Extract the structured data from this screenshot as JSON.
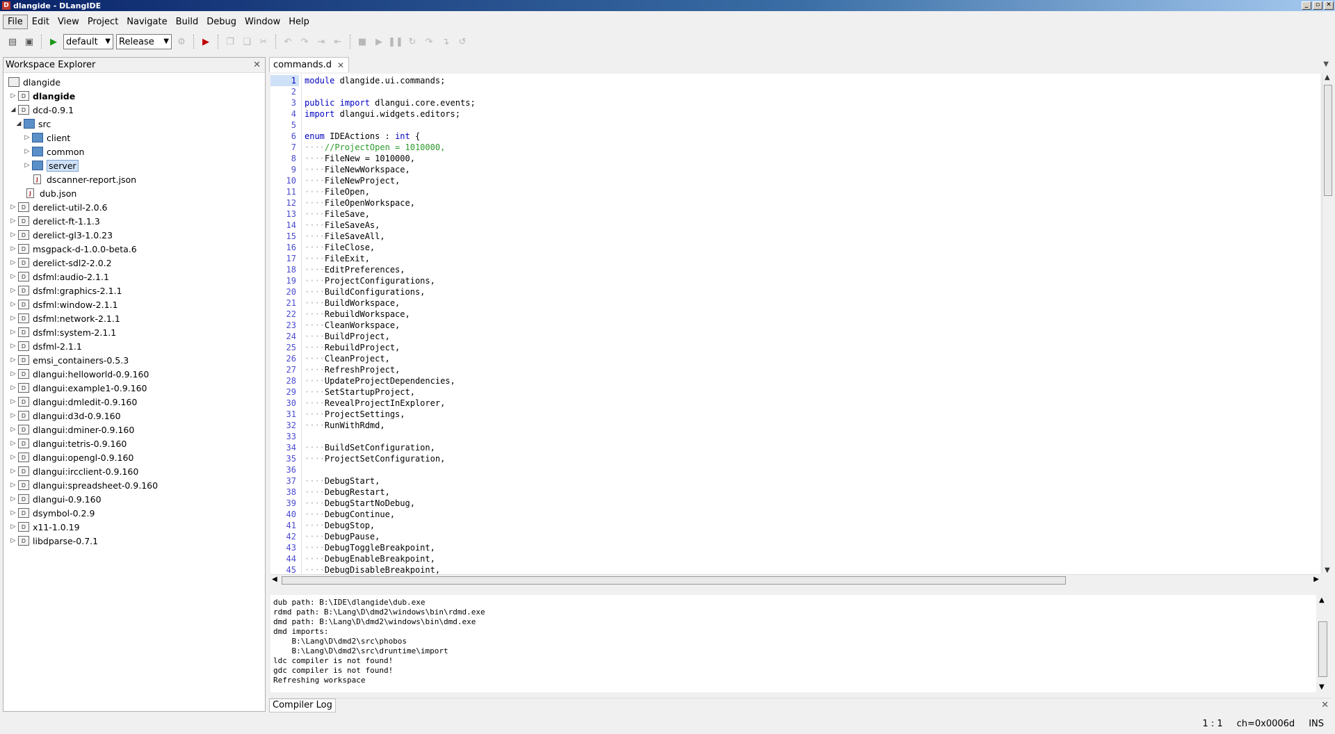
{
  "window": {
    "title": "dlangide - DLangIDE"
  },
  "menu": [
    "File",
    "Edit",
    "View",
    "Project",
    "Navigate",
    "Build",
    "Debug",
    "Window",
    "Help"
  ],
  "toolbar": {
    "config_value": "default",
    "build_value": "Release"
  },
  "workspace": {
    "title": "Workspace Explorer",
    "root": "dlangide",
    "items": [
      {
        "label": "dlangide",
        "bold": true,
        "expanded": false
      },
      {
        "label": "dcd-0.9.1",
        "expanded": true
      },
      {
        "label": "src",
        "folder": true
      },
      {
        "label": "client",
        "folder": true
      },
      {
        "label": "common",
        "folder": true
      },
      {
        "label": "server",
        "folder": true
      },
      {
        "label": "dscanner-report.json"
      },
      {
        "label": "dub.json"
      },
      {
        "label": "derelict-util-2.0.6"
      },
      {
        "label": "derelict-ft-1.1.3"
      },
      {
        "label": "derelict-gl3-1.0.23"
      },
      {
        "label": "msgpack-d-1.0.0-beta.6"
      },
      {
        "label": "derelict-sdl2-2.0.2"
      },
      {
        "label": "dsfml:audio-2.1.1"
      },
      {
        "label": "dsfml:graphics-2.1.1"
      },
      {
        "label": "dsfml:window-2.1.1"
      },
      {
        "label": "dsfml:network-2.1.1"
      },
      {
        "label": "dsfml:system-2.1.1"
      },
      {
        "label": "dsfml-2.1.1"
      },
      {
        "label": "emsi_containers-0.5.3"
      },
      {
        "label": "dlangui:helloworld-0.9.160"
      },
      {
        "label": "dlangui:example1-0.9.160"
      },
      {
        "label": "dlangui:dmledit-0.9.160"
      },
      {
        "label": "dlangui:d3d-0.9.160"
      },
      {
        "label": "dlangui:dminer-0.9.160"
      },
      {
        "label": "dlangui:tetris-0.9.160"
      },
      {
        "label": "dlangui:opengl-0.9.160"
      },
      {
        "label": "dlangui:ircclient-0.9.160"
      },
      {
        "label": "dlangui:spreadsheet-0.9.160"
      },
      {
        "label": "dlangui-0.9.160"
      },
      {
        "label": "dsymbol-0.2.9"
      },
      {
        "label": "x11-1.0.19"
      },
      {
        "label": "libdparse-0.7.1"
      }
    ],
    "icon_label": "D"
  },
  "editor": {
    "tab": "commands.d",
    "lines": [
      "module dlangide.ui.commands;",
      "",
      "public import dlangui.core.events;",
      "import dlangui.widgets.editors;",
      "",
      "enum IDEActions : int {",
      "    //ProjectOpen = 1010000,",
      "    FileNew = 1010000,",
      "    FileNewWorkspace,",
      "    FileNewProject,",
      "    FileOpen,",
      "    FileOpenWorkspace,",
      "    FileSave,",
      "    FileSaveAs,",
      "    FileSaveAll,",
      "    FileClose,",
      "    FileExit,",
      "    EditPreferences,",
      "    ProjectConfigurations,",
      "    BuildConfigurations,",
      "    BuildWorkspace,",
      "    RebuildWorkspace,",
      "    CleanWorkspace,",
      "    BuildProject,",
      "    RebuildProject,",
      "    CleanProject,",
      "    RefreshProject,",
      "    UpdateProjectDependencies,",
      "    SetStartupProject,",
      "    RevealProjectInExplorer,",
      "    ProjectSettings,",
      "    RunWithRdmd,",
      "",
      "    BuildSetConfiguration,",
      "    ProjectSetConfiguration,",
      "",
      "    DebugStart,",
      "    DebugRestart,",
      "    DebugStartNoDebug,",
      "    DebugContinue,",
      "    DebugStop,",
      "    DebugPause,",
      "    DebugToggleBreakpoint,",
      "    DebugEnableBreakpoint,",
      "    DebugDisableBreakpoint,"
    ]
  },
  "log": {
    "tab": "Compiler Log",
    "lines": [
      "dub path: B:\\IDE\\dlangide\\dub.exe",
      "rdmd path: B:\\Lang\\D\\dmd2\\windows\\bin\\rdmd.exe",
      "dmd path: B:\\Lang\\D\\dmd2\\windows\\bin\\dmd.exe",
      "dmd imports:",
      "    B:\\Lang\\D\\dmd2\\src\\phobos",
      "    B:\\Lang\\D\\dmd2\\src\\druntime\\import",
      "ldc compiler is not found!",
      "gdc compiler is not found!",
      "Refreshing workspace"
    ]
  },
  "status": {
    "position": "1 : 1",
    "char": "ch=0x0006d",
    "mode": "INS"
  }
}
